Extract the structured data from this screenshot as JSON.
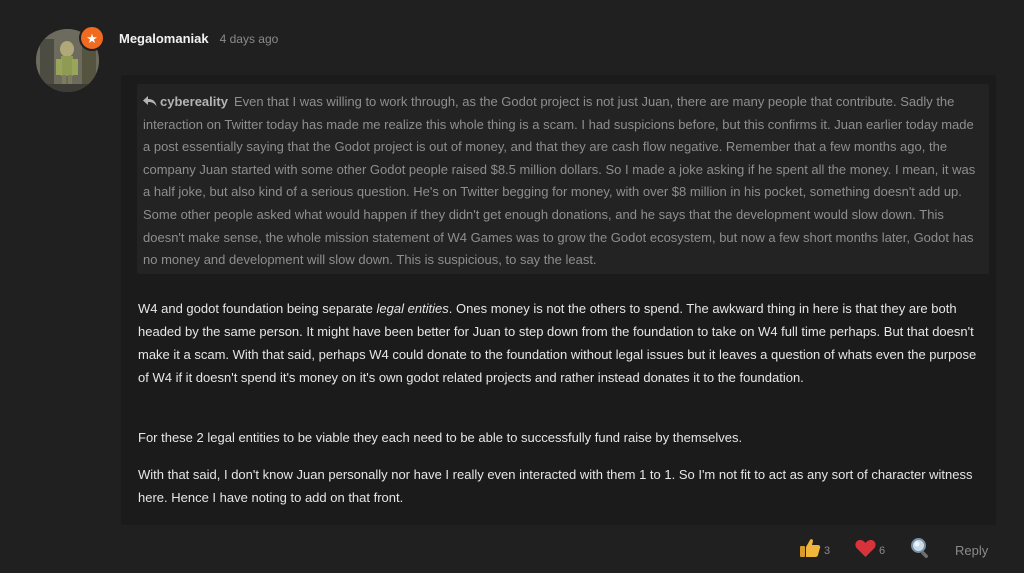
{
  "post": {
    "author": "Megalomaniak",
    "timestamp": "4 days ago",
    "badge_icon": "star-icon",
    "badge_color": "#f06a1f"
  },
  "quote": {
    "author": "cybereality",
    "text": "Even that I was willing to work through, as the Godot project is not just Juan, there are many people that contribute. Sadly the interaction on Twitter today has made me realize this whole thing is a scam. I had suspicions before, but this confirms it. Juan earlier today made a post essentially saying that the Godot project is out of money, and that they are cash flow negative. Remember that a few months ago, the company Juan started with some other Godot people raised $8.5 million dollars. So I made a joke asking if he spent all the money. I mean, it was a half joke, but also kind of a serious question. He's on Twitter begging for money, with over $8 million in his pocket, something doesn't add up. Some other people asked what would happen if they didn't get enough donations, and he says that the development would slow down. This doesn't make sense, the whole mission statement of W4 Games was to grow the Godot ecosystem, but now a few short months later, Godot has no money and development will slow down. This is suspicious, to say the least."
  },
  "reply": {
    "p1_before": "W4 and godot foundation being separate ",
    "p1_emphasis": "legal entities",
    "p1_after": ". Ones money is not the others to spend. The awkward thing in here is that they are both headed by the same person. It might have been better for Juan to step down from the foundation to take on W4 full time perhaps. But that doesn't make it a scam. With that said, perhaps W4 could donate to the foundation without legal issues but it leaves a question of whats even the purpose of W4 if it doesn't spend it's money on it's own godot related projects and rather instead donates it to the foundation.",
    "p2": "For these 2 legal entities to be viable they each need to be able to successfully fund raise by themselves.",
    "p3": "With that said, I don't know Juan personally nor have I really even interacted with them 1 to 1. So I'm not fit to act as any sort of character witness here. Hence I have noting to add on that front."
  },
  "actions": {
    "like_count": "3",
    "like_icon": "thumbs-up-icon",
    "love_count": "6",
    "love_icon": "heart-icon",
    "search_icon": "magnifier-icon",
    "reply_label": "Reply"
  }
}
